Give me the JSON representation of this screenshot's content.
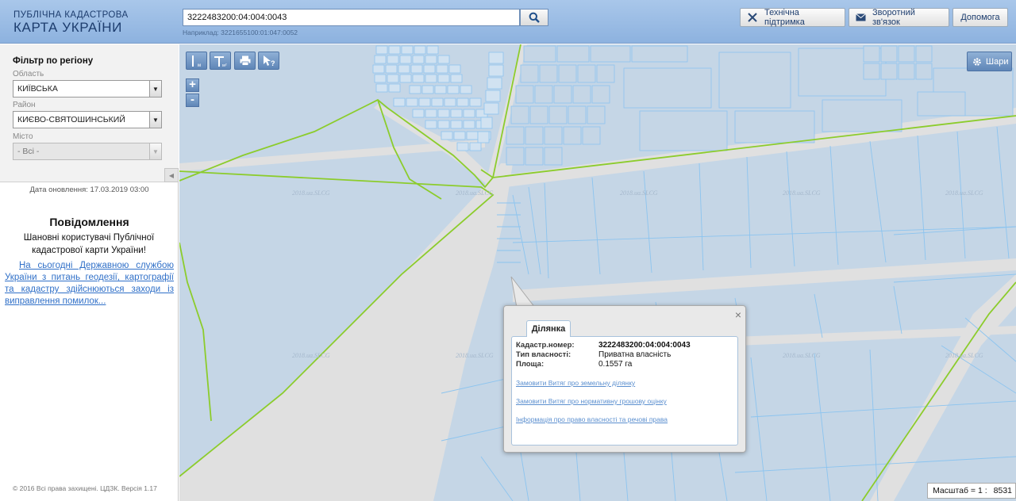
{
  "header": {
    "logo_line1": "ПУБЛІЧНА КАДАСТРОВА",
    "logo_line2": "КАРТА УКРАЇНИ",
    "search_value": "3222483200:04:004:0043",
    "search_hint": "Наприклад: 3221655100:01:047:0052",
    "search_icon": "magnifier-icon",
    "buttons": [
      {
        "label": "Технічна підтримка",
        "icon": "tools-icon"
      },
      {
        "label": "Зворотний зв'язок",
        "icon": "envelope-icon"
      },
      {
        "label": "Допомога"
      }
    ]
  },
  "sidebar": {
    "filter_title": "Фільтр по регіону",
    "oblast_label": "Область",
    "oblast_value": "КИЇВСЬКА",
    "raion_label": "Район",
    "raion_value": "КИЄВО-СВЯТОШИНСЬКИЙ",
    "misto_label": "Місто",
    "misto_value": "- Всі -",
    "update_text": "Дата оновлення: 17.03.2019 03:00",
    "notice_title": "Повідомлення",
    "notice_text": "Шановні користувачі Публічної кадастрової карти України!",
    "notice_link": "На сьогодні Державною службою України з питань геодезії, картографії та кадастру здійснюються заходи із виправлення помилок...",
    "copyright": "© 2016 Всі права захищені. ЦДЗК. Версія 1.17"
  },
  "map": {
    "layers_label": "Шари",
    "layers_icon": "gear-icon",
    "zoom_in": "+",
    "zoom_out": "-",
    "tools": [
      "ruler-icon",
      "area-ruler-icon",
      "print-icon",
      "identify-icon"
    ],
    "watermark": "2018.ua.SLCG",
    "scale_label": "Масштаб = 1 :",
    "scale_value": "8531",
    "colors": {
      "parcel_fill": "#c5d6e6",
      "parcel_line": "#8cc4ef",
      "boundary": "#8ccc2c",
      "road": "#e0e0e0"
    }
  },
  "popup": {
    "tab": "Ділянка",
    "rows": [
      {
        "key": "Кадастр.номер:",
        "value": "3222483200:04:004:0043"
      },
      {
        "key": "Тип власності:",
        "value": "Приватна власність"
      },
      {
        "key": "Площа:",
        "value": "0.1557 га"
      }
    ],
    "links": [
      "Замовити Витяг про земельну ділянку",
      "Замовити Витяг про нормативну грошову оцінку",
      "Інформація про право власності та речові права"
    ]
  }
}
